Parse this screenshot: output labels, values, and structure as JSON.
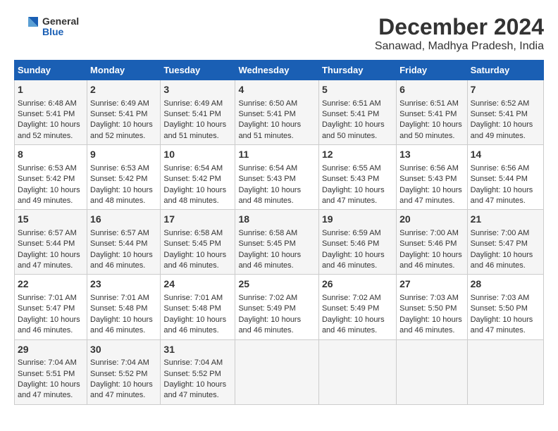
{
  "logo": {
    "line1": "General",
    "line2": "Blue"
  },
  "title": "December 2024",
  "subtitle": "Sanawad, Madhya Pradesh, India",
  "headers": [
    "Sunday",
    "Monday",
    "Tuesday",
    "Wednesday",
    "Thursday",
    "Friday",
    "Saturday"
  ],
  "weeks": [
    [
      {
        "day": "1",
        "sunrise": "Sunrise: 6:48 AM",
        "sunset": "Sunset: 5:41 PM",
        "daylight": "Daylight: 10 hours and 52 minutes."
      },
      {
        "day": "2",
        "sunrise": "Sunrise: 6:49 AM",
        "sunset": "Sunset: 5:41 PM",
        "daylight": "Daylight: 10 hours and 52 minutes."
      },
      {
        "day": "3",
        "sunrise": "Sunrise: 6:49 AM",
        "sunset": "Sunset: 5:41 PM",
        "daylight": "Daylight: 10 hours and 51 minutes."
      },
      {
        "day": "4",
        "sunrise": "Sunrise: 6:50 AM",
        "sunset": "Sunset: 5:41 PM",
        "daylight": "Daylight: 10 hours and 51 minutes."
      },
      {
        "day": "5",
        "sunrise": "Sunrise: 6:51 AM",
        "sunset": "Sunset: 5:41 PM",
        "daylight": "Daylight: 10 hours and 50 minutes."
      },
      {
        "day": "6",
        "sunrise": "Sunrise: 6:51 AM",
        "sunset": "Sunset: 5:41 PM",
        "daylight": "Daylight: 10 hours and 50 minutes."
      },
      {
        "day": "7",
        "sunrise": "Sunrise: 6:52 AM",
        "sunset": "Sunset: 5:41 PM",
        "daylight": "Daylight: 10 hours and 49 minutes."
      }
    ],
    [
      {
        "day": "8",
        "sunrise": "Sunrise: 6:53 AM",
        "sunset": "Sunset: 5:42 PM",
        "daylight": "Daylight: 10 hours and 49 minutes."
      },
      {
        "day": "9",
        "sunrise": "Sunrise: 6:53 AM",
        "sunset": "Sunset: 5:42 PM",
        "daylight": "Daylight: 10 hours and 48 minutes."
      },
      {
        "day": "10",
        "sunrise": "Sunrise: 6:54 AM",
        "sunset": "Sunset: 5:42 PM",
        "daylight": "Daylight: 10 hours and 48 minutes."
      },
      {
        "day": "11",
        "sunrise": "Sunrise: 6:54 AM",
        "sunset": "Sunset: 5:43 PM",
        "daylight": "Daylight: 10 hours and 48 minutes."
      },
      {
        "day": "12",
        "sunrise": "Sunrise: 6:55 AM",
        "sunset": "Sunset: 5:43 PM",
        "daylight": "Daylight: 10 hours and 47 minutes."
      },
      {
        "day": "13",
        "sunrise": "Sunrise: 6:56 AM",
        "sunset": "Sunset: 5:43 PM",
        "daylight": "Daylight: 10 hours and 47 minutes."
      },
      {
        "day": "14",
        "sunrise": "Sunrise: 6:56 AM",
        "sunset": "Sunset: 5:44 PM",
        "daylight": "Daylight: 10 hours and 47 minutes."
      }
    ],
    [
      {
        "day": "15",
        "sunrise": "Sunrise: 6:57 AM",
        "sunset": "Sunset: 5:44 PM",
        "daylight": "Daylight: 10 hours and 47 minutes."
      },
      {
        "day": "16",
        "sunrise": "Sunrise: 6:57 AM",
        "sunset": "Sunset: 5:44 PM",
        "daylight": "Daylight: 10 hours and 46 minutes."
      },
      {
        "day": "17",
        "sunrise": "Sunrise: 6:58 AM",
        "sunset": "Sunset: 5:45 PM",
        "daylight": "Daylight: 10 hours and 46 minutes."
      },
      {
        "day": "18",
        "sunrise": "Sunrise: 6:58 AM",
        "sunset": "Sunset: 5:45 PM",
        "daylight": "Daylight: 10 hours and 46 minutes."
      },
      {
        "day": "19",
        "sunrise": "Sunrise: 6:59 AM",
        "sunset": "Sunset: 5:46 PM",
        "daylight": "Daylight: 10 hours and 46 minutes."
      },
      {
        "day": "20",
        "sunrise": "Sunrise: 7:00 AM",
        "sunset": "Sunset: 5:46 PM",
        "daylight": "Daylight: 10 hours and 46 minutes."
      },
      {
        "day": "21",
        "sunrise": "Sunrise: 7:00 AM",
        "sunset": "Sunset: 5:47 PM",
        "daylight": "Daylight: 10 hours and 46 minutes."
      }
    ],
    [
      {
        "day": "22",
        "sunrise": "Sunrise: 7:01 AM",
        "sunset": "Sunset: 5:47 PM",
        "daylight": "Daylight: 10 hours and 46 minutes."
      },
      {
        "day": "23",
        "sunrise": "Sunrise: 7:01 AM",
        "sunset": "Sunset: 5:48 PM",
        "daylight": "Daylight: 10 hours and 46 minutes."
      },
      {
        "day": "24",
        "sunrise": "Sunrise: 7:01 AM",
        "sunset": "Sunset: 5:48 PM",
        "daylight": "Daylight: 10 hours and 46 minutes."
      },
      {
        "day": "25",
        "sunrise": "Sunrise: 7:02 AM",
        "sunset": "Sunset: 5:49 PM",
        "daylight": "Daylight: 10 hours and 46 minutes."
      },
      {
        "day": "26",
        "sunrise": "Sunrise: 7:02 AM",
        "sunset": "Sunset: 5:49 PM",
        "daylight": "Daylight: 10 hours and 46 minutes."
      },
      {
        "day": "27",
        "sunrise": "Sunrise: 7:03 AM",
        "sunset": "Sunset: 5:50 PM",
        "daylight": "Daylight: 10 hours and 46 minutes."
      },
      {
        "day": "28",
        "sunrise": "Sunrise: 7:03 AM",
        "sunset": "Sunset: 5:50 PM",
        "daylight": "Daylight: 10 hours and 47 minutes."
      }
    ],
    [
      {
        "day": "29",
        "sunrise": "Sunrise: 7:04 AM",
        "sunset": "Sunset: 5:51 PM",
        "daylight": "Daylight: 10 hours and 47 minutes."
      },
      {
        "day": "30",
        "sunrise": "Sunrise: 7:04 AM",
        "sunset": "Sunset: 5:52 PM",
        "daylight": "Daylight: 10 hours and 47 minutes."
      },
      {
        "day": "31",
        "sunrise": "Sunrise: 7:04 AM",
        "sunset": "Sunset: 5:52 PM",
        "daylight": "Daylight: 10 hours and 47 minutes."
      },
      null,
      null,
      null,
      null
    ]
  ]
}
